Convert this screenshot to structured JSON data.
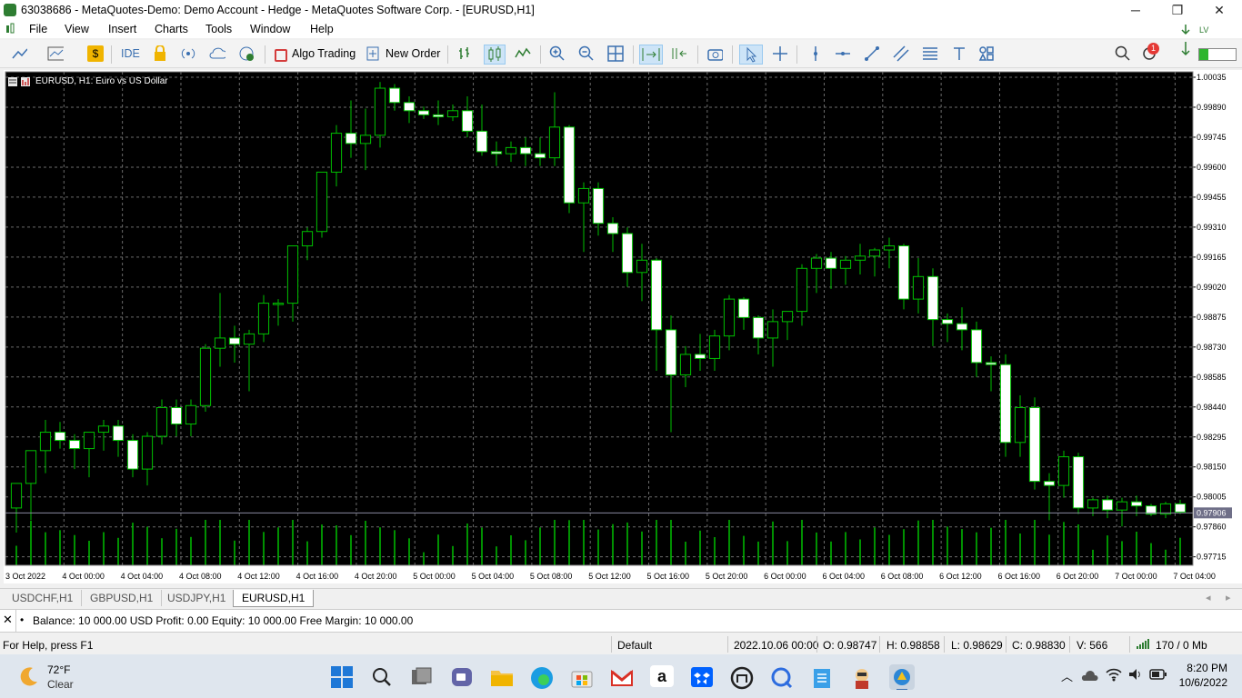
{
  "window": {
    "title": "63038686 - MetaQuotes-Demo: Demo Account - Hedge - MetaQuotes Software Corp. - [EURUSD,H1]",
    "minimize_glyph": "─",
    "restore_glyph": "❐",
    "close_glyph": "✕"
  },
  "menu": {
    "items": [
      "File",
      "View",
      "Insert",
      "Charts",
      "Tools",
      "Window",
      "Help"
    ]
  },
  "toolbar": {
    "ide_label": "IDE",
    "algo_label": "Algo Trading",
    "new_order_label": "New Order",
    "notification_count": "1"
  },
  "chart": {
    "label": "EURUSD, H1:  Euro vs US Dollar",
    "background": "#000000",
    "grid_color": "#6b6b6b",
    "candle_color": "#00c000",
    "price_axis": [
      "1.00035",
      "0.99890",
      "0.99745",
      "0.99600",
      "0.99455",
      "0.99310",
      "0.99165",
      "0.99020",
      "0.98875",
      "0.98730",
      "0.98585",
      "0.98440",
      "0.98295",
      "0.98150",
      "0.98005",
      "0.97860",
      "0.97715"
    ],
    "current_price": "0.97906",
    "time_axis": [
      "3 Oct 2022",
      "4 Oct 00:00",
      "4 Oct 04:00",
      "4 Oct 08:00",
      "4 Oct 12:00",
      "4 Oct 16:00",
      "4 Oct 20:00",
      "5 Oct 00:00",
      "5 Oct 04:00",
      "5 Oct 08:00",
      "5 Oct 12:00",
      "5 Oct 16:00",
      "5 Oct 20:00",
      "6 Oct 00:00",
      "6 Oct 04:00",
      "6 Oct 08:00",
      "6 Oct 12:00",
      "6 Oct 16:00",
      "6 Oct 20:00",
      "7 Oct 00:00",
      "7 Oct 04:00"
    ]
  },
  "chart_data": {
    "type": "candlestick",
    "symbol": "EURUSD",
    "timeframe": "H1",
    "ylim": [
      0.9765,
      1.0006
    ],
    "candles": [
      [
        0.9793,
        0.9796,
        0.9781,
        0.9805
      ],
      [
        0.9805,
        0.9817,
        0.9787,
        0.9821
      ],
      [
        0.9821,
        0.9836,
        0.981,
        0.983
      ],
      [
        0.983,
        0.9835,
        0.9822,
        0.9826
      ],
      [
        0.9826,
        0.9829,
        0.9812,
        0.9822
      ],
      [
        0.9822,
        0.9828,
        0.9808,
        0.983
      ],
      [
        0.983,
        0.9836,
        0.9821,
        0.9833
      ],
      [
        0.9833,
        0.9836,
        0.9818,
        0.9826
      ],
      [
        0.9826,
        0.9829,
        0.9808,
        0.9812
      ],
      [
        0.9812,
        0.983,
        0.9804,
        0.9828
      ],
      [
        0.9828,
        0.9846,
        0.9824,
        0.9842
      ],
      [
        0.9842,
        0.9846,
        0.9828,
        0.9834
      ],
      [
        0.9834,
        0.9846,
        0.9828,
        0.9843
      ],
      [
        0.9843,
        0.9873,
        0.984,
        0.9871
      ],
      [
        0.9871,
        0.9898,
        0.9862,
        0.9876
      ],
      [
        0.9876,
        0.9882,
        0.9864,
        0.9873
      ],
      [
        0.9873,
        0.988,
        0.985,
        0.9878
      ],
      [
        0.9878,
        0.9897,
        0.9874,
        0.9893
      ],
      [
        0.9893,
        0.9895,
        0.9882,
        0.9893
      ],
      [
        0.9893,
        0.992,
        0.9884,
        0.9921
      ],
      [
        0.9921,
        0.993,
        0.9914,
        0.9928
      ],
      [
        0.9928,
        0.9946,
        0.9925,
        0.9957
      ],
      [
        0.9957,
        0.998,
        0.995,
        0.9976
      ],
      [
        0.9976,
        0.9992,
        0.9964,
        0.9971
      ],
      [
        0.9971,
        0.9988,
        0.9958,
        0.9975
      ],
      [
        0.9975,
        1.0001,
        0.9969,
        0.9998
      ],
      [
        0.9998,
        1.0,
        0.9987,
        0.9991
      ],
      [
        0.9991,
        0.9994,
        0.9981,
        0.9987
      ],
      [
        0.9987,
        0.9989,
        0.9983,
        0.9985
      ],
      [
        0.9985,
        0.9992,
        0.998,
        0.9984
      ],
      [
        0.9984,
        0.999,
        0.9982,
        0.9987
      ],
      [
        0.9987,
        0.9994,
        0.9974,
        0.9977
      ],
      [
        0.9977,
        0.999,
        0.9965,
        0.9967
      ],
      [
        0.9967,
        0.9972,
        0.996,
        0.9966
      ],
      [
        0.9966,
        0.9972,
        0.9962,
        0.9969
      ],
      [
        0.9969,
        0.9974,
        0.996,
        0.9966
      ],
      [
        0.9966,
        0.9974,
        0.996,
        0.9964
      ],
      [
        0.9964,
        0.9996,
        0.996,
        0.9979
      ],
      [
        0.9979,
        0.998,
        0.9937,
        0.9942
      ],
      [
        0.9942,
        0.9952,
        0.9918,
        0.9949
      ],
      [
        0.9949,
        0.9952,
        0.9926,
        0.9932
      ],
      [
        0.9932,
        0.9935,
        0.9918,
        0.9927
      ],
      [
        0.9927,
        0.993,
        0.9901,
        0.9908
      ],
      [
        0.9908,
        0.9922,
        0.9894,
        0.9914
      ],
      [
        0.9914,
        0.9915,
        0.986,
        0.988
      ],
      [
        0.988,
        0.9887,
        0.983,
        0.9858
      ],
      [
        0.9858,
        0.9872,
        0.9852,
        0.9868
      ],
      [
        0.9868,
        0.9878,
        0.986,
        0.9866
      ],
      [
        0.9866,
        0.988,
        0.986,
        0.9877
      ],
      [
        0.9877,
        0.9897,
        0.987,
        0.9895
      ],
      [
        0.9895,
        0.9896,
        0.988,
        0.9886
      ],
      [
        0.9886,
        0.9887,
        0.9868,
        0.9876
      ],
      [
        0.9876,
        0.989,
        0.9862,
        0.9884
      ],
      [
        0.9884,
        0.9889,
        0.9875,
        0.9889
      ],
      [
        0.9889,
        0.9912,
        0.9882,
        0.991
      ],
      [
        0.991,
        0.9917,
        0.9898,
        0.9915
      ],
      [
        0.9915,
        0.9918,
        0.99,
        0.991
      ],
      [
        0.991,
        0.9916,
        0.9902,
        0.9914
      ],
      [
        0.9914,
        0.9922,
        0.9907,
        0.9916
      ],
      [
        0.9916,
        0.992,
        0.9906,
        0.9919
      ],
      [
        0.9919,
        0.9925,
        0.991,
        0.9921
      ],
      [
        0.9921,
        0.9922,
        0.989,
        0.9895
      ],
      [
        0.9895,
        0.9915,
        0.9888,
        0.9906
      ],
      [
        0.9906,
        0.991,
        0.9872,
        0.9885
      ],
      [
        0.9885,
        0.9888,
        0.9874,
        0.9883
      ],
      [
        0.9883,
        0.9891,
        0.987,
        0.988
      ],
      [
        0.988,
        0.9884,
        0.9857,
        0.9864
      ],
      [
        0.9864,
        0.9867,
        0.985,
        0.9863
      ],
      [
        0.9863,
        0.9868,
        0.9818,
        0.9825
      ],
      [
        0.9825,
        0.9848,
        0.9818,
        0.9842
      ],
      [
        0.9842,
        0.9847,
        0.9802,
        0.9806
      ],
      [
        0.9806,
        0.981,
        0.9787,
        0.9804
      ],
      [
        0.9804,
        0.9821,
        0.9798,
        0.9818
      ],
      [
        0.9818,
        0.982,
        0.979,
        0.9793
      ],
      [
        0.9793,
        0.9798,
        0.9789,
        0.9797
      ],
      [
        0.9797,
        0.9799,
        0.9788,
        0.9792
      ],
      [
        0.9792,
        0.9798,
        0.9784,
        0.9796
      ],
      [
        0.9796,
        0.9799,
        0.9789,
        0.9794
      ],
      [
        0.9794,
        0.9795,
        0.9789,
        0.979
      ],
      [
        0.979,
        0.9796,
        0.9788,
        0.9795
      ],
      [
        0.9795,
        0.9797,
        0.979,
        0.9791
      ]
    ]
  },
  "tabs": [
    "USDCHF,H1",
    "GBPUSD,H1",
    "USDJPY,H1",
    "EURUSD,H1"
  ],
  "terminal": {
    "text": "Balance: 10 000.00 USD  Profit: 0.00  Equity: 10 000.00  Free Margin: 10 000.00"
  },
  "statusbar": {
    "help": "For Help, press F1",
    "profile": "Default",
    "datetime": "2022.10.06 00:00",
    "open": "O: 0.98747",
    "high": "H: 0.98858",
    "low": "L: 0.98629",
    "close": "C: 0.98830",
    "volume": "V: 566",
    "traffic": "170 / 0 Mb"
  },
  "taskbar": {
    "temp": "72°F",
    "weather": "Clear",
    "time": "8:20 PM",
    "date": "10/6/2022",
    "amazon_glyph": "a"
  }
}
